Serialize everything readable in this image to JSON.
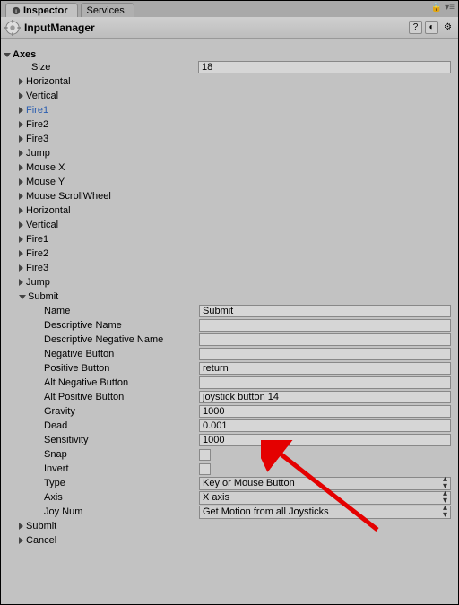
{
  "tabs": {
    "inspector": "Inspector",
    "services": "Services"
  },
  "header": {
    "title": "InputManager"
  },
  "axes": {
    "label": "Axes",
    "size_label": "Size",
    "size_value": "18",
    "items": [
      "Horizontal",
      "Vertical",
      "Fire1",
      "Fire2",
      "Fire3",
      "Jump",
      "Mouse X",
      "Mouse Y",
      "Mouse ScrollWheel",
      "Horizontal",
      "Vertical",
      "Fire1",
      "Fire2",
      "Fire3",
      "Jump",
      "Submit",
      "Submit",
      "Cancel"
    ],
    "selected_index": 2,
    "expanded_index": 15
  },
  "submit": {
    "fields": {
      "name_label": "Name",
      "name_value": "Submit",
      "desc_name_label": "Descriptive Name",
      "desc_name_value": "",
      "desc_neg_label": "Descriptive Negative Name",
      "desc_neg_value": "",
      "neg_btn_label": "Negative Button",
      "neg_btn_value": "",
      "pos_btn_label": "Positive Button",
      "pos_btn_value": "return",
      "alt_neg_label": "Alt Negative Button",
      "alt_neg_value": "",
      "alt_pos_label": "Alt Positive Button",
      "alt_pos_value": "joystick button 14",
      "gravity_label": "Gravity",
      "gravity_value": "1000",
      "dead_label": "Dead",
      "dead_value": "0.001",
      "sensitivity_label": "Sensitivity",
      "sensitivity_value": "1000",
      "snap_label": "Snap",
      "invert_label": "Invert",
      "type_label": "Type",
      "type_value": "Key or Mouse Button",
      "axis_label": "Axis",
      "axis_value": "X axis",
      "joynum_label": "Joy Num",
      "joynum_value": "Get Motion from all Joysticks"
    }
  }
}
